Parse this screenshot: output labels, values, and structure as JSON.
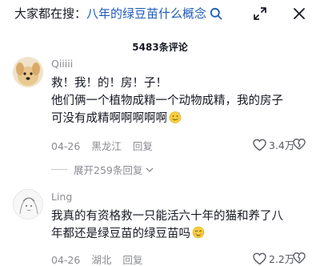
{
  "search_bar": {
    "prefix": "大家都在搜：",
    "query": "八年的绿豆苗什么概念",
    "icon": "search-icon"
  },
  "header": {
    "comment_count": "5483条评论"
  },
  "comments": [
    {
      "username": "Qiiiii",
      "lines": [
        "救！我！的！房！子！",
        "他们俩一个植物成精一个动物成精，我的房子",
        "可没有成精啊啊啊啊啊"
      ],
      "emoji": "grimacing-sweat-emoji",
      "date": "04-26",
      "location": "黑龙江",
      "reply_label": "回复",
      "likes": "3.4万",
      "expand_replies": "展开259条回复"
    },
    {
      "username": "Ling",
      "lines": [
        "我真的有资格救一只能活六十年的猫和养了八",
        "年都还是绿豆苗的绿豆苗吗"
      ],
      "emoji": "blushing-emoji",
      "date": "04-26",
      "location": "湖北",
      "reply_label": "回复",
      "likes": "2.2万"
    }
  ],
  "colors": {
    "query_link": "#1f5bbd",
    "muted": "#8a8b91",
    "text": "#161823"
  }
}
